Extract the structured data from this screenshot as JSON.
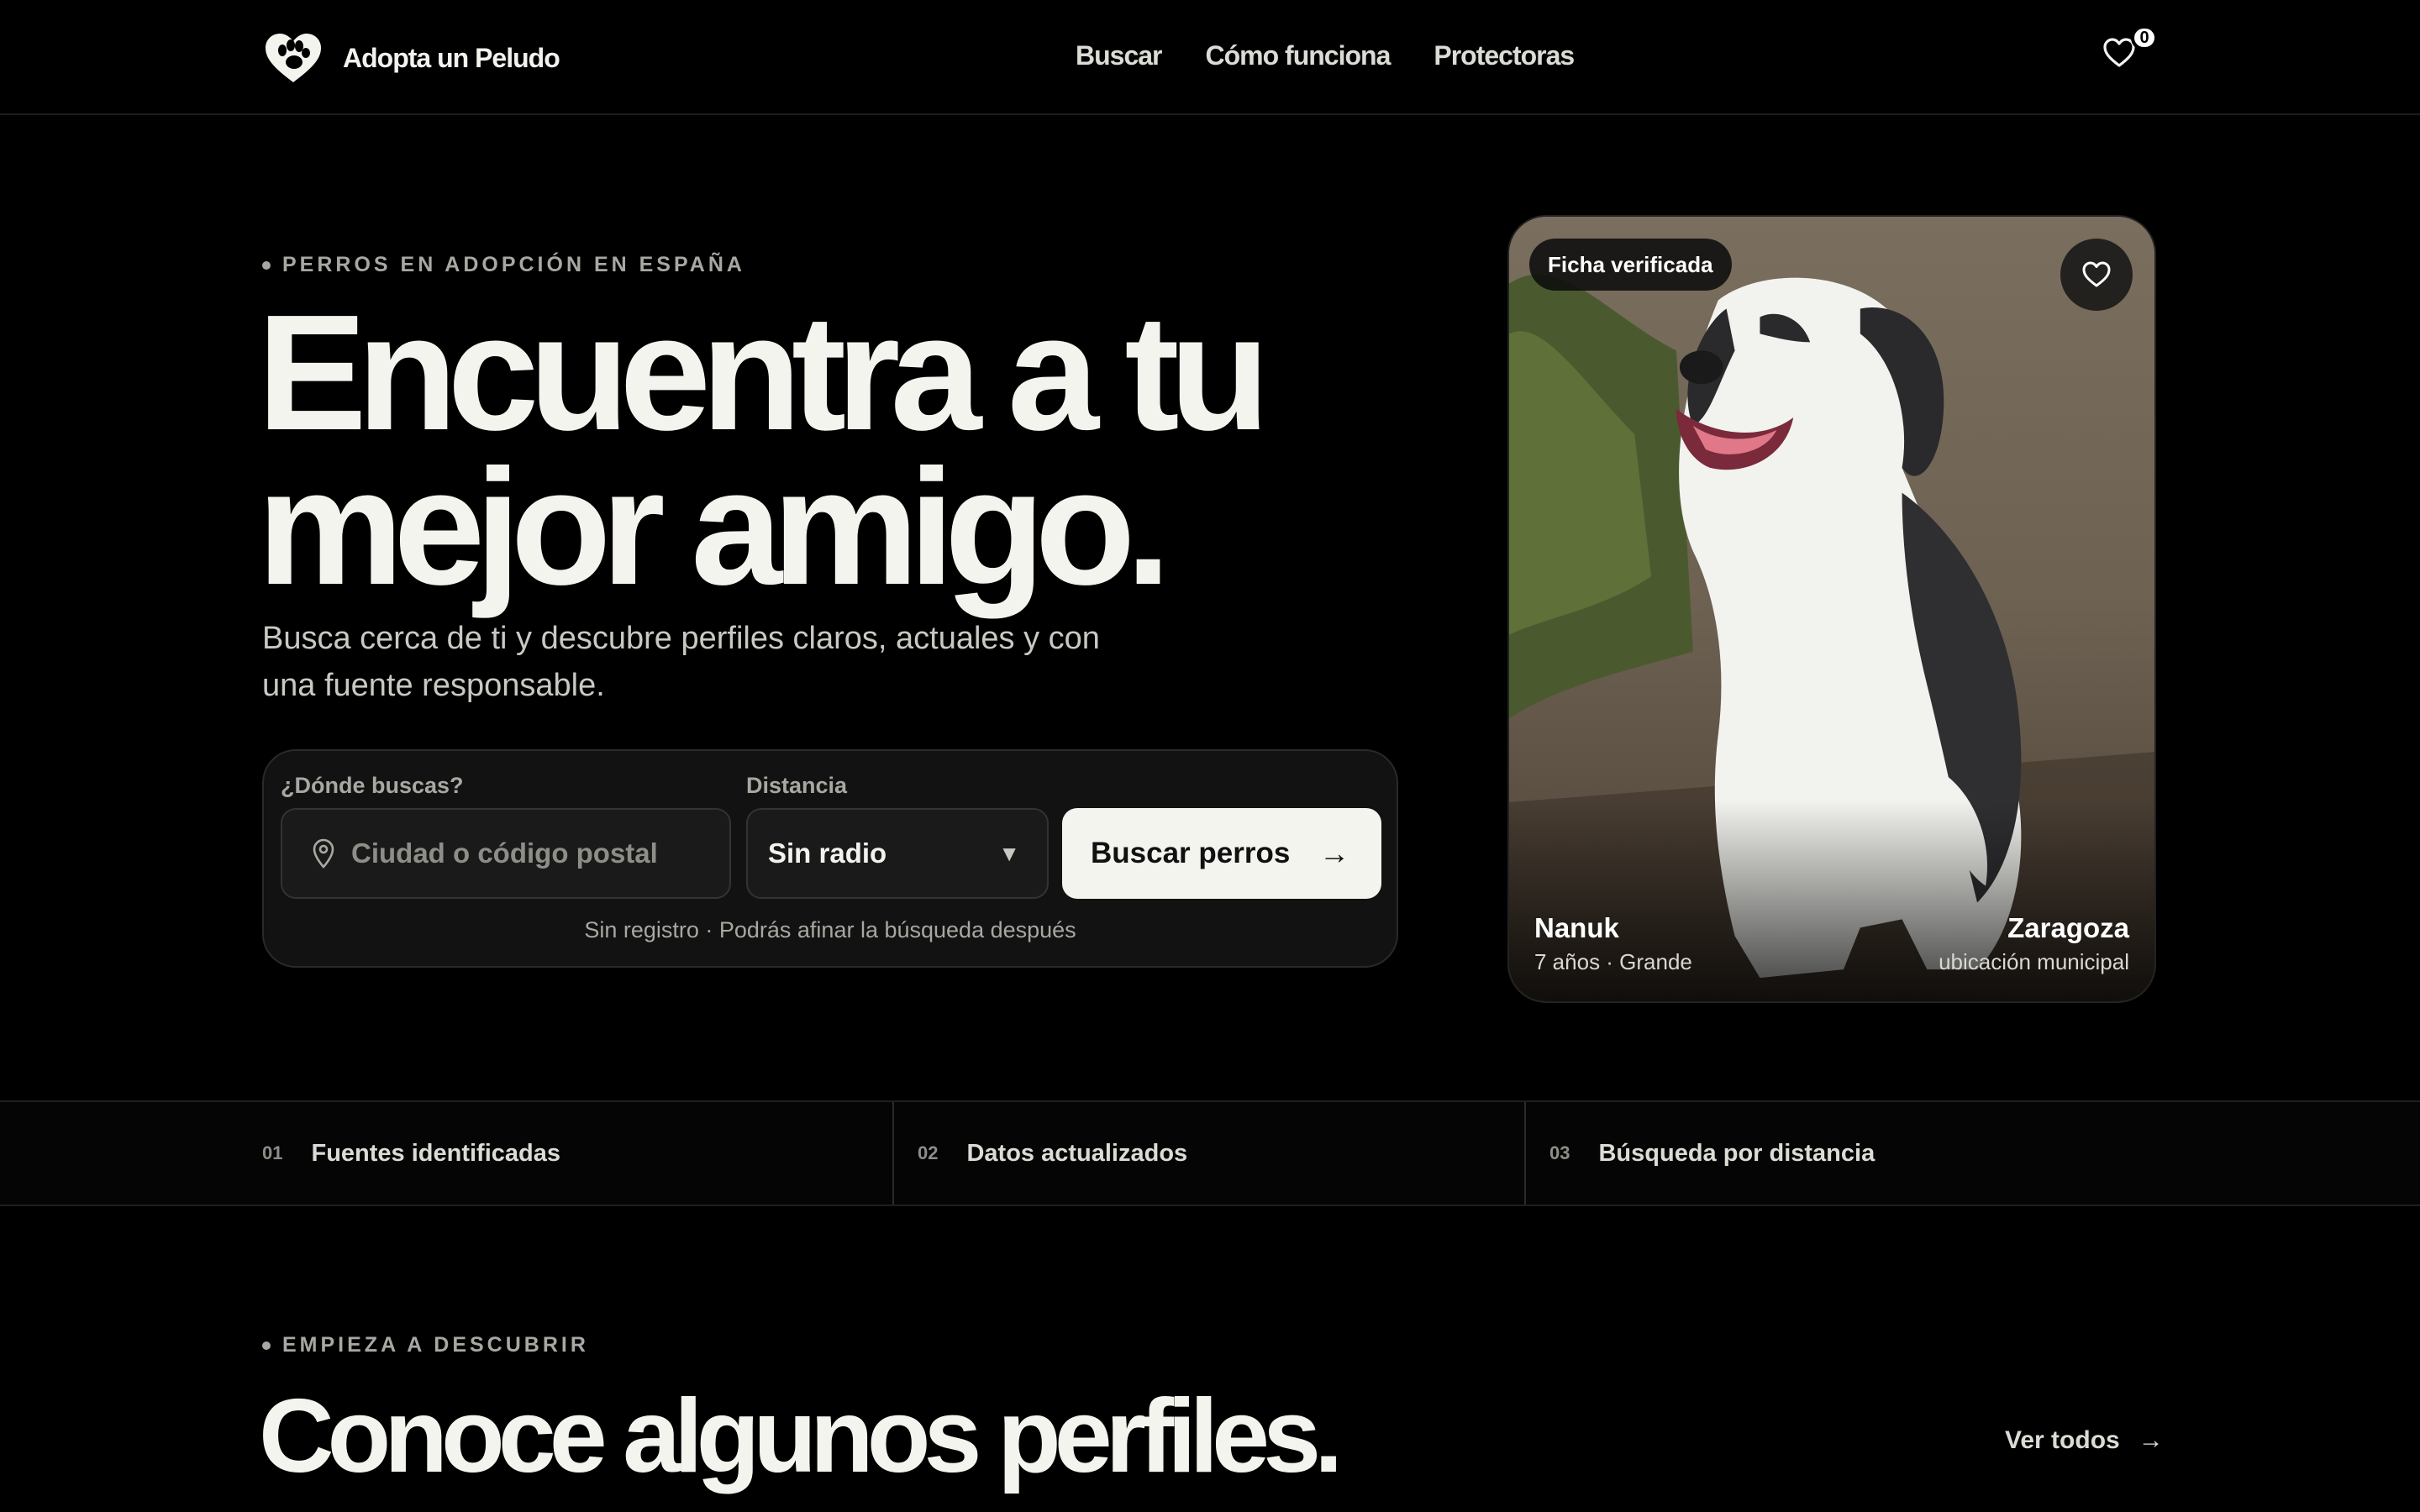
{
  "header": {
    "brand_name": "Adopta un Peludo",
    "nav": [
      "Buscar",
      "Cómo funciona",
      "Protectoras"
    ],
    "favorites_count": "0"
  },
  "hero": {
    "eyebrow": "PERROS EN ADOPCIÓN EN ESPAÑA",
    "title_line1": "Encuentra a tu",
    "title_line2": "mejor amigo.",
    "subtitle": "Busca cerca de ti y descubre perfiles claros, actuales y con una fuente responsable."
  },
  "search": {
    "location_label": "¿Dónde buscas?",
    "location_placeholder": "Ciudad o código postal",
    "location_value": "",
    "distance_label": "Distancia",
    "distance_value": "Sin radio",
    "button_label": "Buscar perros",
    "button_arrow": "→",
    "note": "Sin registro · Podrás afinar la búsqueda después"
  },
  "featured": {
    "badge": "Ficha verificada",
    "name": "Nanuk",
    "meta": "7 años · Grande",
    "city": "Zaragoza",
    "location_note": "ubicación municipal"
  },
  "features": [
    {
      "num": "01",
      "label": "Fuentes identificadas"
    },
    {
      "num": "02",
      "label": "Datos actualizados"
    },
    {
      "num": "03",
      "label": "Búsqueda por distancia"
    }
  ],
  "profiles": {
    "eyebrow": "EMPIEZA A DESCUBRIR",
    "title": "Conoce algunos perfiles.",
    "see_all": "Ver todos",
    "see_all_arrow": "→"
  },
  "icons": {
    "logo": "paw-heart-icon",
    "favorites": "heart-icon",
    "location": "map-pin-icon",
    "dropdown": "caret-down-icon"
  },
  "colors": {
    "background": "#000000",
    "text": "#f2f2ee",
    "muted": "#a8a8a2",
    "button": "#f4f4ef"
  }
}
